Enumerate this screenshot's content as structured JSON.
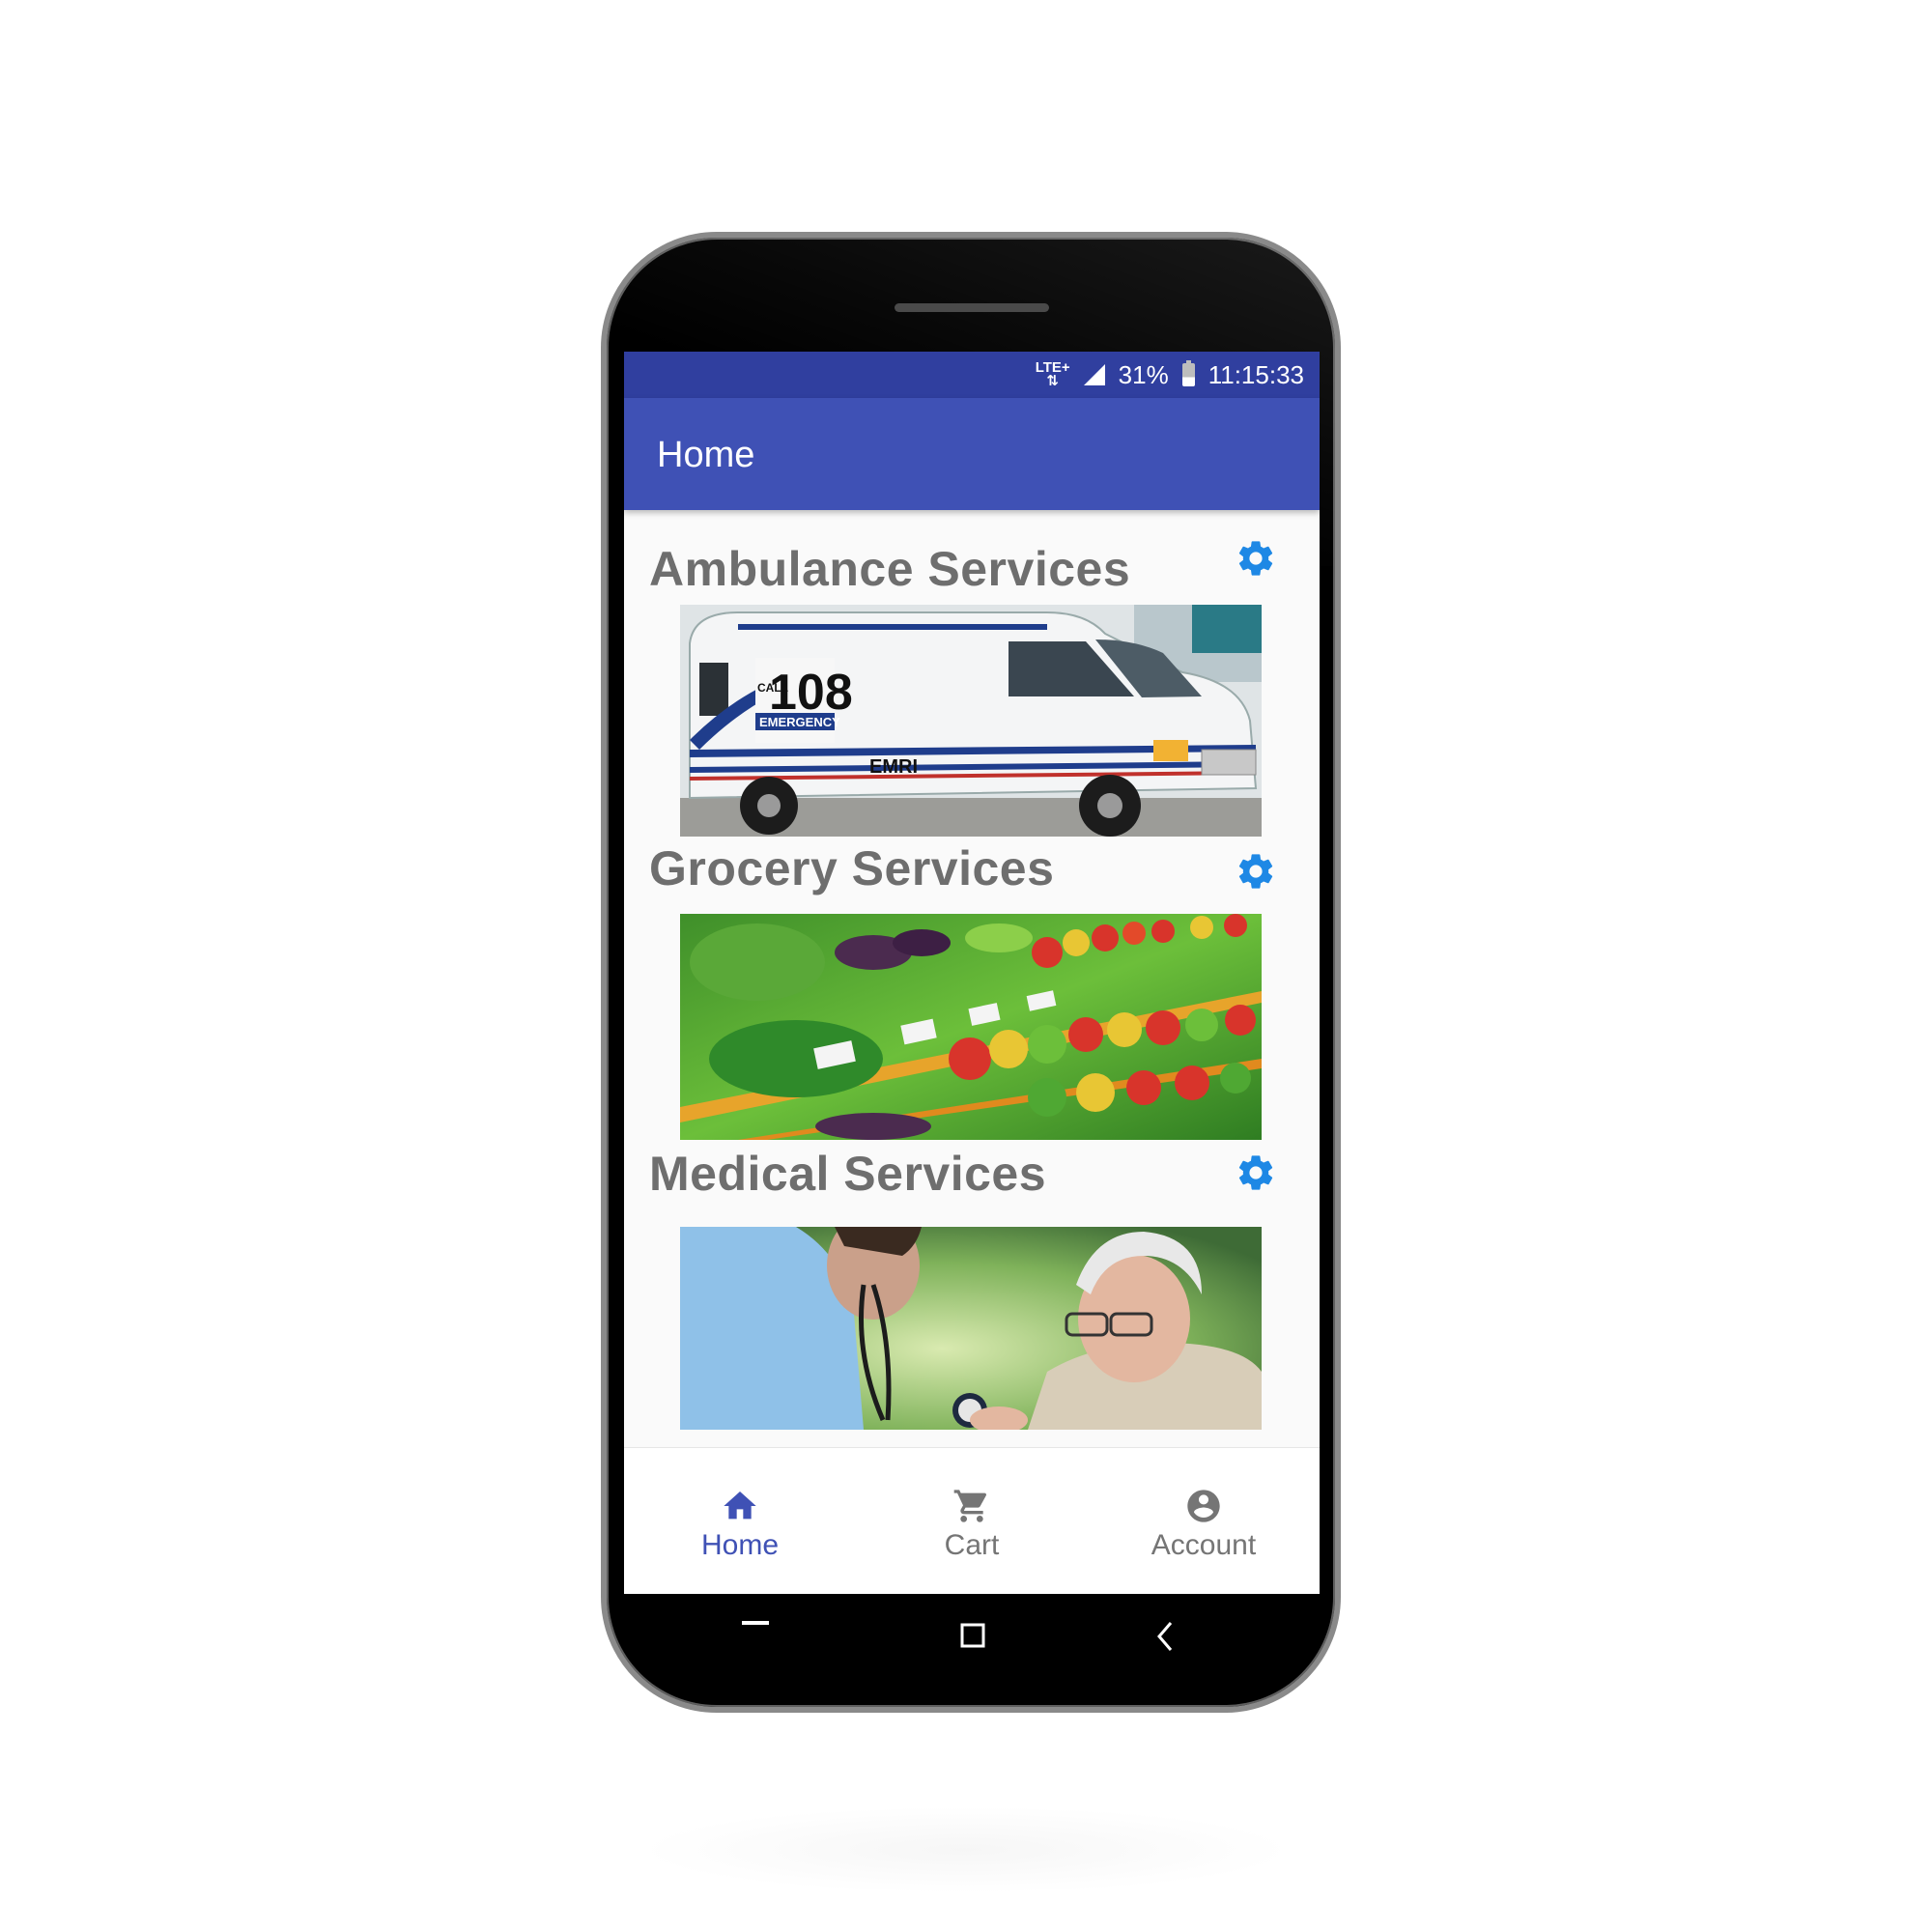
{
  "status_bar": {
    "network": "LTE+",
    "battery": "31%",
    "time": "11:15:33"
  },
  "app_bar": {
    "title": "Home"
  },
  "services": [
    {
      "title": "Ambulance Services",
      "image": "ambulance-photo",
      "settings_icon": "gear-icon"
    },
    {
      "title": "Grocery Services",
      "image": "grocery-produce-photo",
      "settings_icon": "gear-icon"
    },
    {
      "title": "Medical Services",
      "image": "doctor-patient-photo",
      "settings_icon": "gear-icon"
    }
  ],
  "ambulance_photo": {
    "call_label": "CALL",
    "number": "108",
    "emergency": "EMERGENCY",
    "org": "EMRI"
  },
  "bottom_nav": [
    {
      "label": "Home",
      "icon": "home-icon",
      "active": true
    },
    {
      "label": "Cart",
      "icon": "cart-icon",
      "active": false
    },
    {
      "label": "Account",
      "icon": "account-circle-icon",
      "active": false
    }
  ],
  "colors": {
    "status_bar": "#303f9f",
    "app_bar": "#3f51b5",
    "accent_active": "#3f51b5",
    "gear": "#1e88e5",
    "title_text": "#6e6e6e",
    "inactive_nav": "#757575"
  }
}
